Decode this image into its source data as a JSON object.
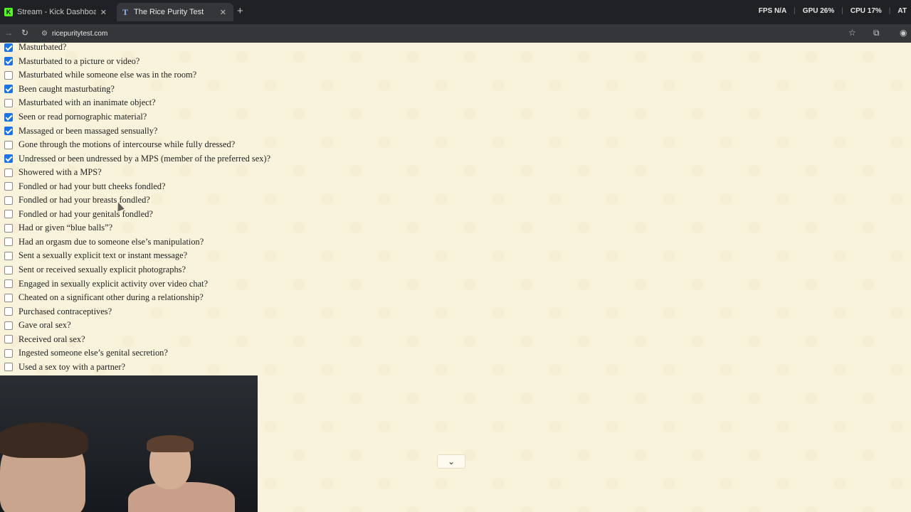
{
  "tabs": [
    {
      "title": "Stream - Kick Dashboard",
      "favicon": "K",
      "active": false
    },
    {
      "title": "The Rice Purity Test",
      "favicon": "T",
      "active": true
    }
  ],
  "stats": {
    "fps_label": "FPS",
    "fps_value": "N/A",
    "gpu_label": "GPU",
    "gpu_value": "26%",
    "cpu_label": "CPU",
    "cpu_value": "17%",
    "extra": "AT"
  },
  "address": {
    "url": "ricepuritytest.com"
  },
  "questions": [
    {
      "text": "Masturbated?",
      "checked": true
    },
    {
      "text": "Masturbated to a picture or video?",
      "checked": true
    },
    {
      "text": "Masturbated while someone else was in the room?",
      "checked": false
    },
    {
      "text": "Been caught masturbating?",
      "checked": true
    },
    {
      "text": "Masturbated with an inanimate object?",
      "checked": false
    },
    {
      "text": "Seen or read pornographic material?",
      "checked": true
    },
    {
      "text": "Massaged or been massaged sensually?",
      "checked": true
    },
    {
      "text": "Gone through the motions of intercourse while fully dressed?",
      "checked": false
    },
    {
      "text": "Undressed or been undressed by a MPS (member of the preferred sex)?",
      "checked": true
    },
    {
      "text": "Showered with a MPS?",
      "checked": false
    },
    {
      "text": "Fondled or had your butt cheeks fondled?",
      "checked": false
    },
    {
      "text": "Fondled or had your breasts fondled?",
      "checked": false
    },
    {
      "text": "Fondled or had your genitals fondled?",
      "checked": false
    },
    {
      "text": "Had or given “blue balls”?",
      "checked": false
    },
    {
      "text": "Had an orgasm due to someone else’s manipulation?",
      "checked": false
    },
    {
      "text": "Sent a sexually explicit text or instant message?",
      "checked": false
    },
    {
      "text": "Sent or received sexually explicit photographs?",
      "checked": false
    },
    {
      "text": "Engaged in sexually explicit activity over video chat?",
      "checked": false
    },
    {
      "text": "Cheated on a significant other during a relationship?",
      "checked": false
    },
    {
      "text": "Purchased contraceptives?",
      "checked": false
    },
    {
      "text": "Gave oral sex?",
      "checked": false
    },
    {
      "text": "Received oral sex?",
      "checked": false
    },
    {
      "text": "Ingested someone else’s genital secretion?",
      "checked": false
    },
    {
      "text": "Used a sex toy with a partner?",
      "checked": false
    }
  ],
  "icons": {
    "back": "back-arrow-icon",
    "reload": "reload-icon",
    "bookmark": "star-icon",
    "extensions": "puzzle-icon",
    "profile": "profile-icon",
    "scroll": "chevron-down-icon"
  },
  "colors": {
    "page_bg": "#faf3dc",
    "checkbox_checked": "#1a73e8"
  }
}
